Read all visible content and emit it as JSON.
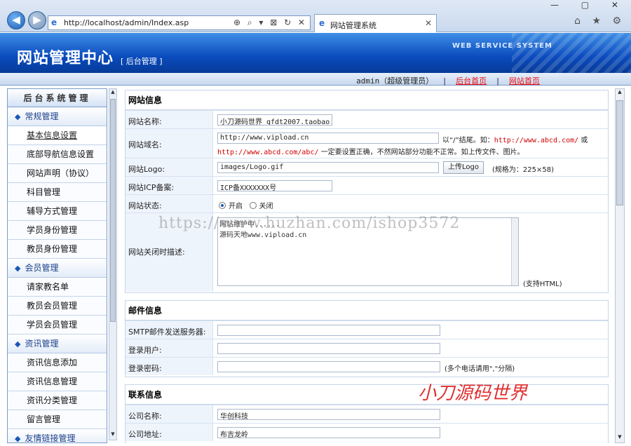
{
  "browser": {
    "url": "http://localhost/admin/Index.asp",
    "tab_title": "网站管理系统",
    "tab_close": "✕",
    "toolbar_icons": "⌂ ★ ⚙",
    "window_buttons": "— ▢ ✕",
    "addr_icons": "⊕ ⌕ ▾ ⊠ ↻ ✕"
  },
  "header": {
    "title": "网站管理中心",
    "subtitle": "[ 后台管理 ]",
    "ws_text": "WEB SERVICE SYSTEM"
  },
  "userbar": {
    "user": "admin（超级管理员）",
    "link1": "后台首页",
    "link2": "网站首页",
    "sep": "|"
  },
  "sidebar": {
    "title": "后台系统管理",
    "groups": [
      {
        "label": "常规管理",
        "items": [
          "基本信息设置",
          "底部导航信息设置",
          "网站声明（协议）",
          "科目管理",
          "辅导方式管理",
          "学员身份管理",
          "教员身份管理"
        ]
      },
      {
        "label": "会员管理",
        "items": [
          "请家教名单",
          "教员会员管理",
          "学员会员管理"
        ]
      },
      {
        "label": "资讯管理",
        "items": [
          "资讯信息添加",
          "资讯信息管理",
          "资讯分类管理",
          "留言管理"
        ]
      },
      {
        "label": "友情链接管理",
        "items": []
      }
    ]
  },
  "site_info": {
    "title": "网站信息",
    "name_label": "网站名称:",
    "name_value": "小刀源码世界 qfdt2007.taobao.com",
    "domain_label": "网站域名:",
    "domain_value": "http://www.vipload.cn",
    "domain_hint1": "以“/”结尾。如：",
    "domain_example1": "http://www.abcd.com/",
    "domain_or": "或",
    "domain_example2": "http://www.abcd.com/abc/",
    "domain_hint2": "一定要设置正确，不然网站部分功能不正常。如上传文件、图片。",
    "logo_label": "网站Logo:",
    "logo_value": "images/Logo.gif",
    "logo_button": "上传Logo",
    "logo_size": "(规格为：225×58)",
    "icp_label": "网站ICP备案:",
    "icp_value": "ICP备XXXXXXX号",
    "status_label": "网站状态:",
    "status_on": "开启",
    "status_off": "关闭",
    "close_desc_label": "网站关闭时描述:",
    "close_desc_line1": "网站维护中......",
    "close_desc_line2": "源码天地www.vipload.cn",
    "html_support": "(支持HTML)"
  },
  "mail_info": {
    "title": "邮件信息",
    "smtp_label": "SMTP邮件发送服务器:",
    "user_label": "登录用户:",
    "pass_label": "登录密码:",
    "pass_hint": "(多个电话请用\",\"分隔)"
  },
  "contact_info": {
    "title": "联系信息",
    "company_label": "公司名称:",
    "company_value": "华创科技",
    "address_label": "公司地址:",
    "address_value": "布吉龙岭"
  },
  "overlay": {
    "watermark": "https://www.huzhan.com/ishop3572",
    "stamp": "小刀源码世界"
  }
}
